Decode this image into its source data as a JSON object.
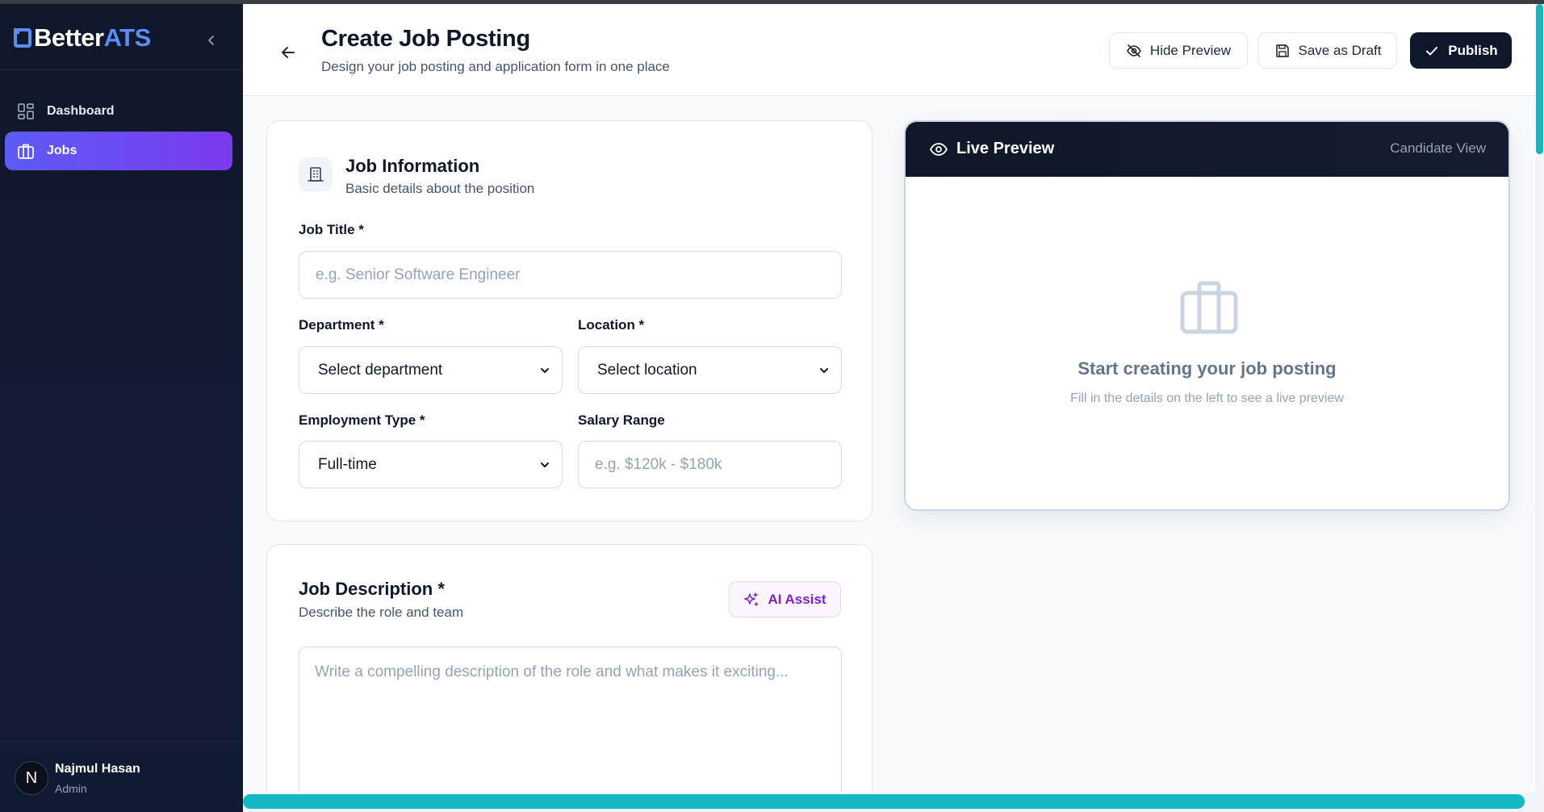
{
  "brand": {
    "part1": "Better",
    "part2": "ATS"
  },
  "sidebar": {
    "items": [
      {
        "label": "Dashboard",
        "icon": "dashboard-grid-icon",
        "active": false
      },
      {
        "label": "Jobs",
        "icon": "briefcase-icon",
        "active": true
      }
    ],
    "user": {
      "initial": "N",
      "name": "Najmul Hasan",
      "role": "Admin"
    }
  },
  "header": {
    "title": "Create Job Posting",
    "subtitle": "Design your job posting and application form in one place",
    "hide_preview": "Hide Preview",
    "save_draft": "Save as Draft",
    "publish": "Publish"
  },
  "job_info": {
    "title": "Job Information",
    "subtitle": "Basic details about the position",
    "job_title_label": "Job Title *",
    "job_title_placeholder": "e.g. Senior Software Engineer",
    "department_label": "Department *",
    "department_value": "Select department",
    "location_label": "Location *",
    "location_value": "Select location",
    "employment_label": "Employment Type *",
    "employment_value": "Full-time",
    "salary_label": "Salary Range",
    "salary_placeholder": "e.g. $120k - $180k"
  },
  "job_description": {
    "title": "Job Description *",
    "subtitle": "Describe the role and team",
    "ai_assist": "AI Assist",
    "placeholder": "Write a compelling description of the role and what makes it exciting..."
  },
  "preview": {
    "title": "Live Preview",
    "view": "Candidate View",
    "empty_title": "Start creating your job posting",
    "empty_subtitle": "Fill in the details on the left to see a live preview"
  },
  "colors": {
    "accent": "#5b8cf7",
    "active_nav_start": "#5b5cf6",
    "active_nav_end": "#7c3aed",
    "primary_button": "#0f172a",
    "scrollbar": "#14b8c4",
    "ai_purple": "#7e22ce"
  }
}
